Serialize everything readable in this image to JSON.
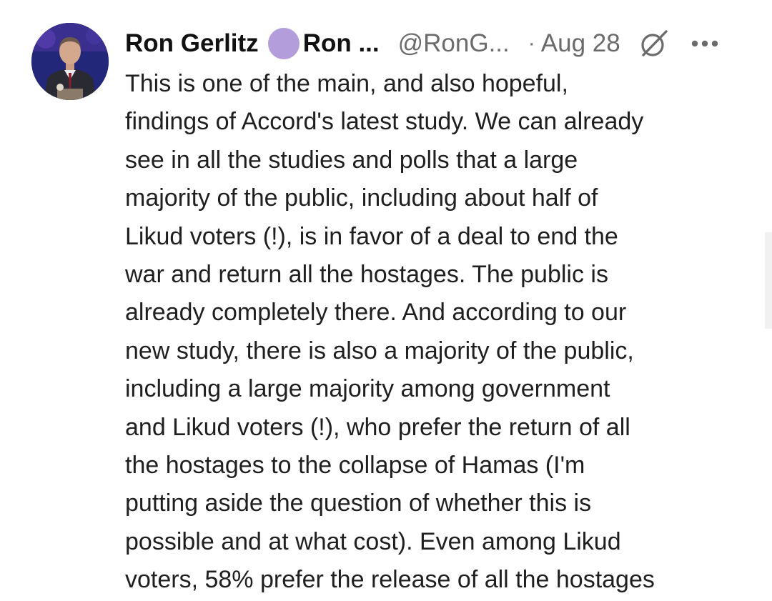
{
  "post": {
    "author": {
      "display_name": "Ron Gerlitz",
      "second_name": "Ron ...",
      "handle": "@RonG...",
      "avatar_icon": "person-avatar",
      "badge_color": "#b39ddb"
    },
    "meta": {
      "separator": "·",
      "date": "Aug 28",
      "bridge_icon": "bridgy-crossed-circle-icon",
      "more_icon": "more-horizontal-icon"
    },
    "text_lines": [
      "This is one of the main, and also hopeful,",
      "findings of Accord's latest study. We can already",
      "see in all the studies and polls that a large",
      "majority of the public, including about half of",
      "Likud voters (!), is in favor of a deal to end the",
      "war and return all the hostages. The public is",
      "already completely there. And according to our",
      "new study, there is also a majority of the public,",
      "including a large majority among government",
      "and Likud voters (!), who prefer the return of all",
      "the hostages to the collapse of Hamas (I'm",
      "putting aside the question of whether this is",
      "possible and at what cost). Even among Likud",
      "voters, 58% prefer the release of all the hostages"
    ]
  }
}
